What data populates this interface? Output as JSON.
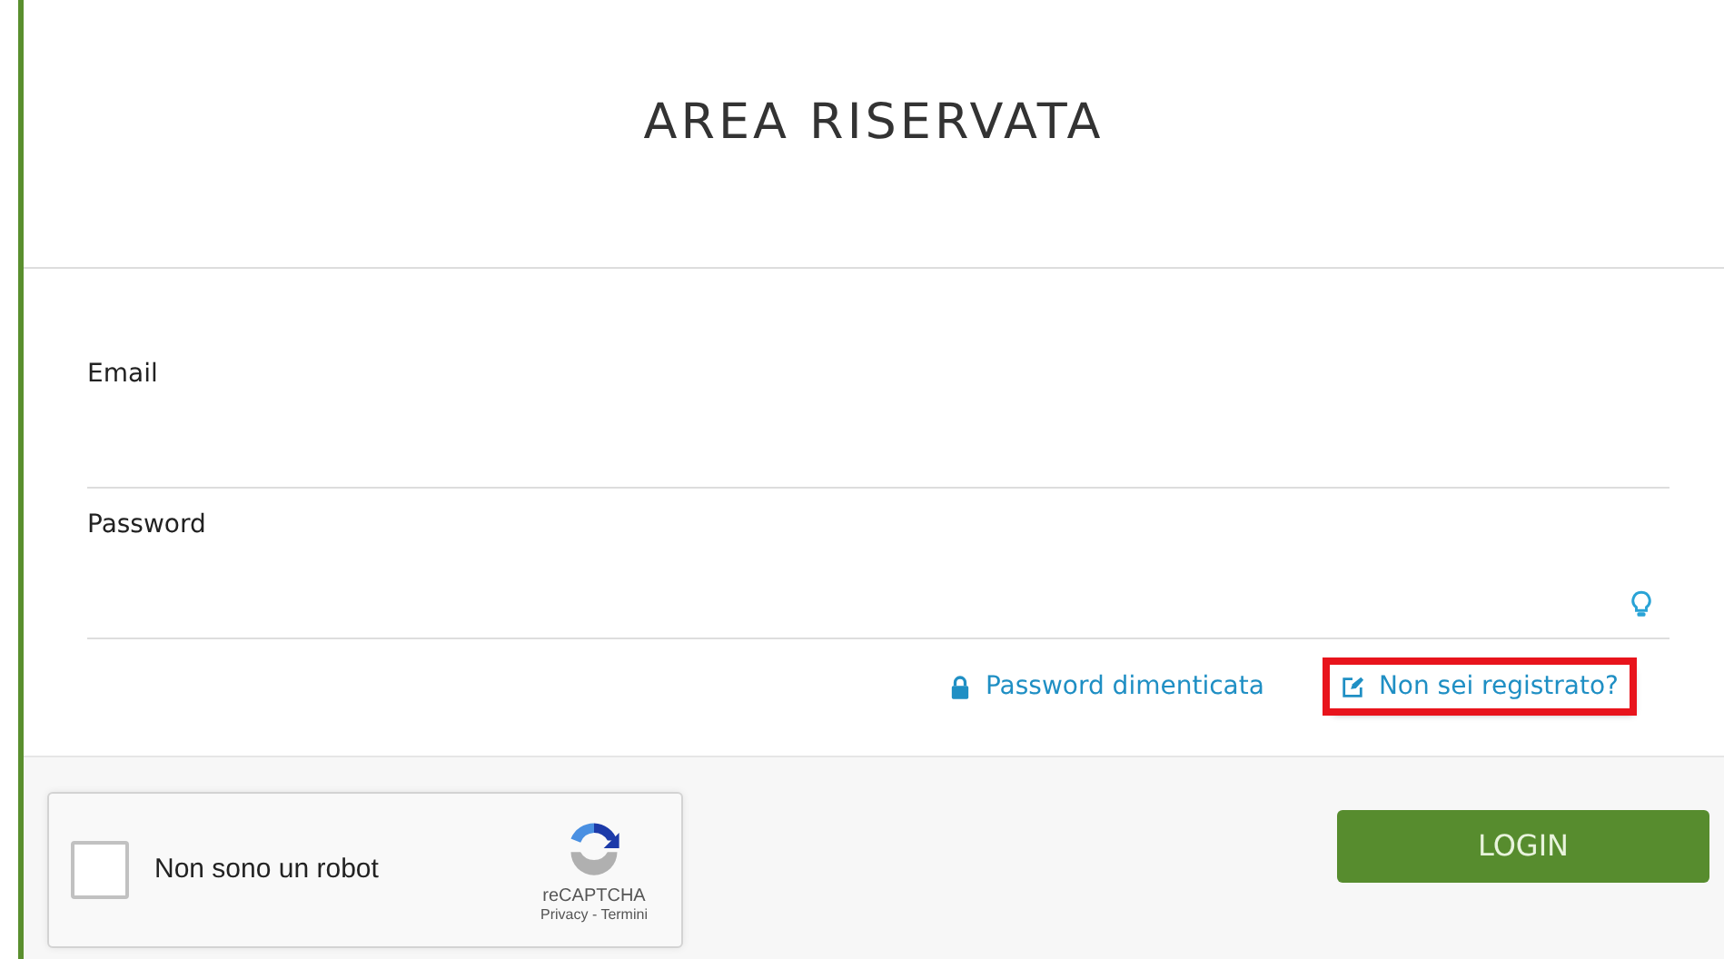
{
  "title": "AREA RISERVATA",
  "fields": [
    {
      "label": "Email",
      "kind": "text"
    },
    {
      "label": "Password",
      "kind": "password"
    }
  ],
  "links": [
    {
      "label": "Password dimenticata",
      "kind": "lock",
      "highlighted": false
    },
    {
      "label": "Non sei registrato?",
      "kind": "edit",
      "highlighted": true
    }
  ],
  "captcha": {
    "label": "Non sono un robot",
    "checked": false,
    "brand": "reCAPTCHA",
    "footer": "Privacy - Termini"
  },
  "login_button": "LOGIN"
}
